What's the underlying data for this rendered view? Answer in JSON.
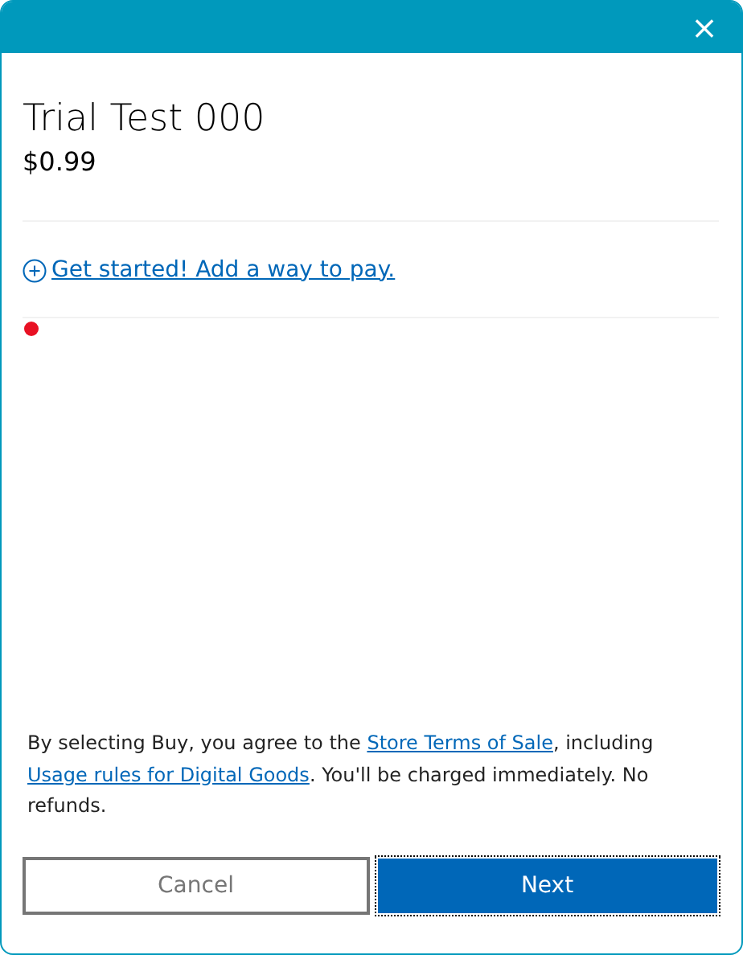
{
  "window": {
    "close": "×"
  },
  "product": {
    "title": "Trial Test 000",
    "price": "$0.99"
  },
  "add_payment": {
    "label": "Get started! Add a way to pay."
  },
  "legal": [
    {
      "kind": "text",
      "text": "By selecting Buy, you agree to the "
    },
    {
      "kind": "link",
      "text": "Store Terms of Sale"
    },
    {
      "kind": "text",
      "text": ", including "
    },
    {
      "kind": "link",
      "text": "Usage rules for Digital Goods"
    },
    {
      "kind": "text",
      "text": ". You'll be charged immediately. No refunds."
    }
  ],
  "buttons": [
    {
      "label": "Cancel",
      "kind": "secondary",
      "focused": false
    },
    {
      "label": "Next",
      "kind": "primary",
      "focused": true
    }
  ]
}
